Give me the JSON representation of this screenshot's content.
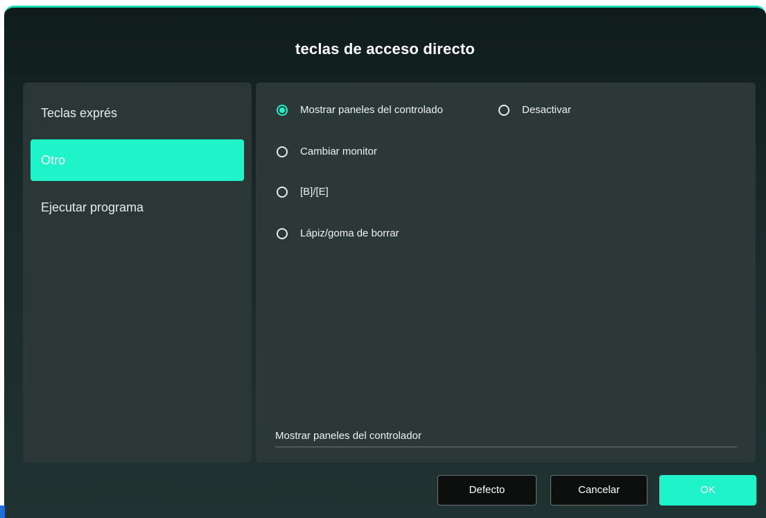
{
  "dialog": {
    "title": "teclas de acceso directo"
  },
  "sidebar": {
    "items": [
      {
        "label": "Teclas exprés",
        "active": false
      },
      {
        "label": "Otro",
        "active": true
      },
      {
        "label": "Ejecutar programa",
        "active": false
      }
    ]
  },
  "options": {
    "radios": [
      {
        "label": "Mostrar paneles del controlado",
        "checked": true
      },
      {
        "label": "Desactivar",
        "checked": false
      },
      {
        "label": "Cambiar monitor",
        "checked": false
      },
      {
        "label": "[B]/[E]",
        "checked": false
      },
      {
        "label": "Lápiz/goma de borrar",
        "checked": false
      }
    ],
    "selected_summary": "Mostrar paneles del controlador"
  },
  "footer": {
    "default_label": "Defecto",
    "cancel_label": "Cancelar",
    "ok_label": "OK"
  },
  "colors": {
    "accent": "#1ff3c9",
    "panel": "#2b3837",
    "background": "#1a2a29"
  }
}
